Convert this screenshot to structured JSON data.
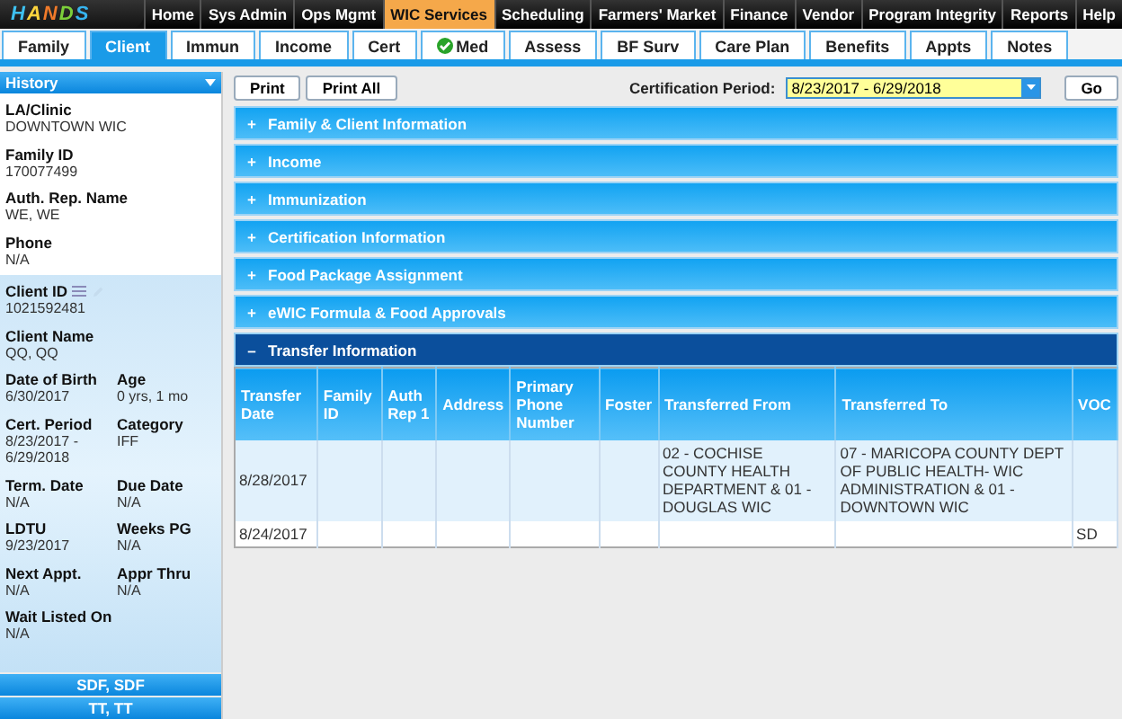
{
  "logo": {
    "letters": [
      "H",
      "A",
      "N",
      "D",
      "S"
    ]
  },
  "top_menu": [
    {
      "label": "Home",
      "selected": false
    },
    {
      "label": "Sys Admin",
      "selected": false
    },
    {
      "label": "Ops Mgmt",
      "selected": false
    },
    {
      "label": "WIC Services",
      "selected": true
    },
    {
      "label": "Scheduling",
      "selected": false
    },
    {
      "label": "Farmers' Market",
      "selected": false
    },
    {
      "label": "Finance",
      "selected": false
    },
    {
      "label": "Vendor",
      "selected": false
    },
    {
      "label": "Program Integrity",
      "selected": false
    },
    {
      "label": "Reports",
      "selected": false
    },
    {
      "label": "Help",
      "selected": false
    }
  ],
  "tabs": [
    {
      "label": "Family",
      "selected": false,
      "checked": false
    },
    {
      "label": "Client",
      "selected": true,
      "checked": false
    },
    {
      "label": "Immun",
      "selected": false,
      "checked": false
    },
    {
      "label": "Income",
      "selected": false,
      "checked": false
    },
    {
      "label": "Cert",
      "selected": false,
      "checked": false
    },
    {
      "label": "Med",
      "selected": false,
      "checked": true
    },
    {
      "label": "Assess",
      "selected": false,
      "checked": false
    },
    {
      "label": "BF Surv",
      "selected": false,
      "checked": false
    },
    {
      "label": "Care Plan",
      "selected": false,
      "checked": false
    },
    {
      "label": "Benefits",
      "selected": false,
      "checked": false
    },
    {
      "label": "Appts",
      "selected": false,
      "checked": false
    },
    {
      "label": "Notes",
      "selected": false,
      "checked": false
    }
  ],
  "sidebar": {
    "header": "History",
    "family_fields": [
      {
        "label": "LA/Clinic",
        "value": "DOWNTOWN WIC"
      },
      {
        "label": "Family ID",
        "value": "170077499"
      },
      {
        "label": "Auth. Rep. Name",
        "value": "WE, WE"
      },
      {
        "label": "Phone",
        "value": "N/A"
      }
    ],
    "client_fields": [
      [
        {
          "label": "Client ID",
          "value": "1021592481",
          "icons": true
        }
      ],
      [
        {
          "label": "Client Name",
          "value": "QQ, QQ"
        }
      ],
      [
        {
          "label": "Date of Birth",
          "value": "6/30/2017"
        },
        {
          "label": "Age",
          "value": "0 yrs, 1 mo"
        }
      ],
      [
        {
          "label": "Cert. Period",
          "value": "8/23/2017 - 6/29/2018"
        },
        {
          "label": "Category",
          "value": "IFF"
        }
      ],
      [
        {
          "label": "Term. Date",
          "value": "N/A"
        },
        {
          "label": "Due Date",
          "value": "N/A"
        }
      ],
      [
        {
          "label": "LDTU",
          "value": "9/23/2017"
        },
        {
          "label": "Weeks PG",
          "value": "N/A"
        }
      ],
      [
        {
          "label": "Next Appt.",
          "value": "N/A"
        },
        {
          "label": "Appr Thru",
          "value": "N/A"
        }
      ],
      [
        {
          "label": "Wait Listed On",
          "value": "N/A"
        }
      ]
    ],
    "members": [
      "SDF, SDF",
      "TT, TT"
    ]
  },
  "toolbar": {
    "buttons": [
      "Print",
      "Print All"
    ],
    "cert_label": "Certification Period:",
    "cert_value": "8/23/2017 - 6/29/2018",
    "go": "Go"
  },
  "sections": [
    {
      "title": "Family & Client Information",
      "expanded": false
    },
    {
      "title": "Income",
      "expanded": false
    },
    {
      "title": "Immunization",
      "expanded": false
    },
    {
      "title": "Certification Information",
      "expanded": false
    },
    {
      "title": "Food Package Assignment",
      "expanded": false
    },
    {
      "title": "eWIC Formula & Food Approvals",
      "expanded": false
    },
    {
      "title": "Transfer Information",
      "expanded": true
    }
  ],
  "sign": {
    "expand": "+",
    "collapse": "–"
  },
  "table": {
    "columns": [
      "Transfer Date",
      "Family ID",
      "Auth Rep 1",
      "Address",
      "Primary Phone Number",
      "Foster",
      "Transferred From",
      "Transferred To",
      "VOC"
    ],
    "rows": [
      [
        "8/28/2017",
        "",
        "",
        "",
        "",
        "",
        "02 - COCHISE COUNTY HEALTH DEPARTMENT & 01 - DOUGLAS WIC",
        "07 - MARICOPA COUNTY DEPT OF PUBLIC HEALTH- WIC ADMINISTRATION & 01 - DOWNTOWN WIC",
        ""
      ],
      [
        "8/24/2017",
        "",
        "",
        "",
        "",
        "",
        "",
        "",
        "SD"
      ]
    ]
  }
}
